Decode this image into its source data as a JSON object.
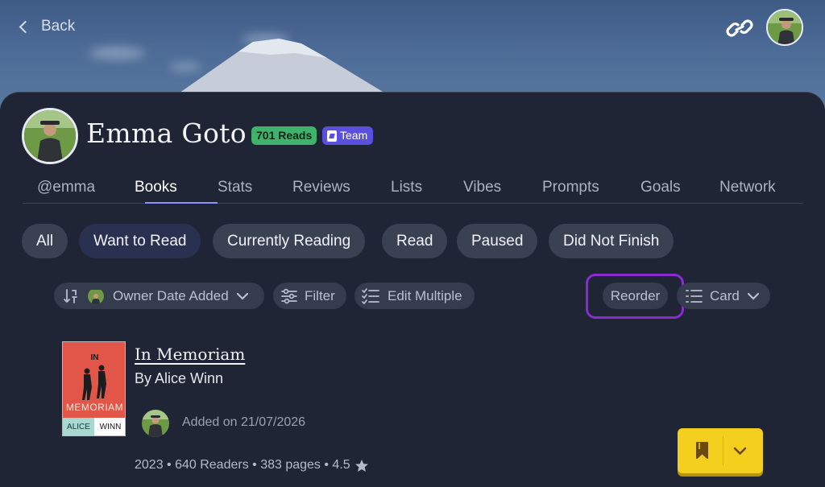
{
  "header": {
    "back_label": "Back"
  },
  "profile": {
    "name": "Emma Goto",
    "reads_badge": "701 Reads",
    "team_badge": "Team"
  },
  "tabs": [
    {
      "label": "@emma"
    },
    {
      "label": "Books",
      "active": true
    },
    {
      "label": "Stats"
    },
    {
      "label": "Reviews"
    },
    {
      "label": "Lists"
    },
    {
      "label": "Vibes"
    },
    {
      "label": "Prompts"
    },
    {
      "label": "Goals"
    },
    {
      "label": "Network"
    }
  ],
  "filters": [
    {
      "label": "All"
    },
    {
      "label": "Want to Read",
      "active": true
    },
    {
      "label": "Currently Reading"
    },
    {
      "label": "Read"
    },
    {
      "label": "Paused"
    },
    {
      "label": "Did Not Finish"
    }
  ],
  "toolbar": {
    "sort_label": "Owner Date Added",
    "filter_label": "Filter",
    "edit_label": "Edit Multiple",
    "reorder_label": "Reorder",
    "view_label": "Card"
  },
  "book": {
    "title": "In Memoriam",
    "author": "By Alice Winn",
    "added": "Added on 21/07/2026",
    "meta": "2023 • 640 Readers • 383 pages • 4.5",
    "cover": {
      "top": "IN",
      "word": "MEMORIAM",
      "first": "ALICE",
      "last": "WINN"
    }
  },
  "colors": {
    "accent": "#8a93ff",
    "reads_badge": "#3fb36b",
    "team_badge": "#5b4fe0",
    "highlight": "#8a2bd2",
    "fab": "#f4cf1e"
  },
  "icons": {
    "back": "chevron-left-icon",
    "link": "link-icon",
    "sort": "sort-icon",
    "filter": "sliders-icon",
    "edit": "checklist-icon",
    "view": "list-icon",
    "rating": "star-icon",
    "bookmark": "bookmark-icon",
    "dropdown": "chevron-down-icon"
  }
}
